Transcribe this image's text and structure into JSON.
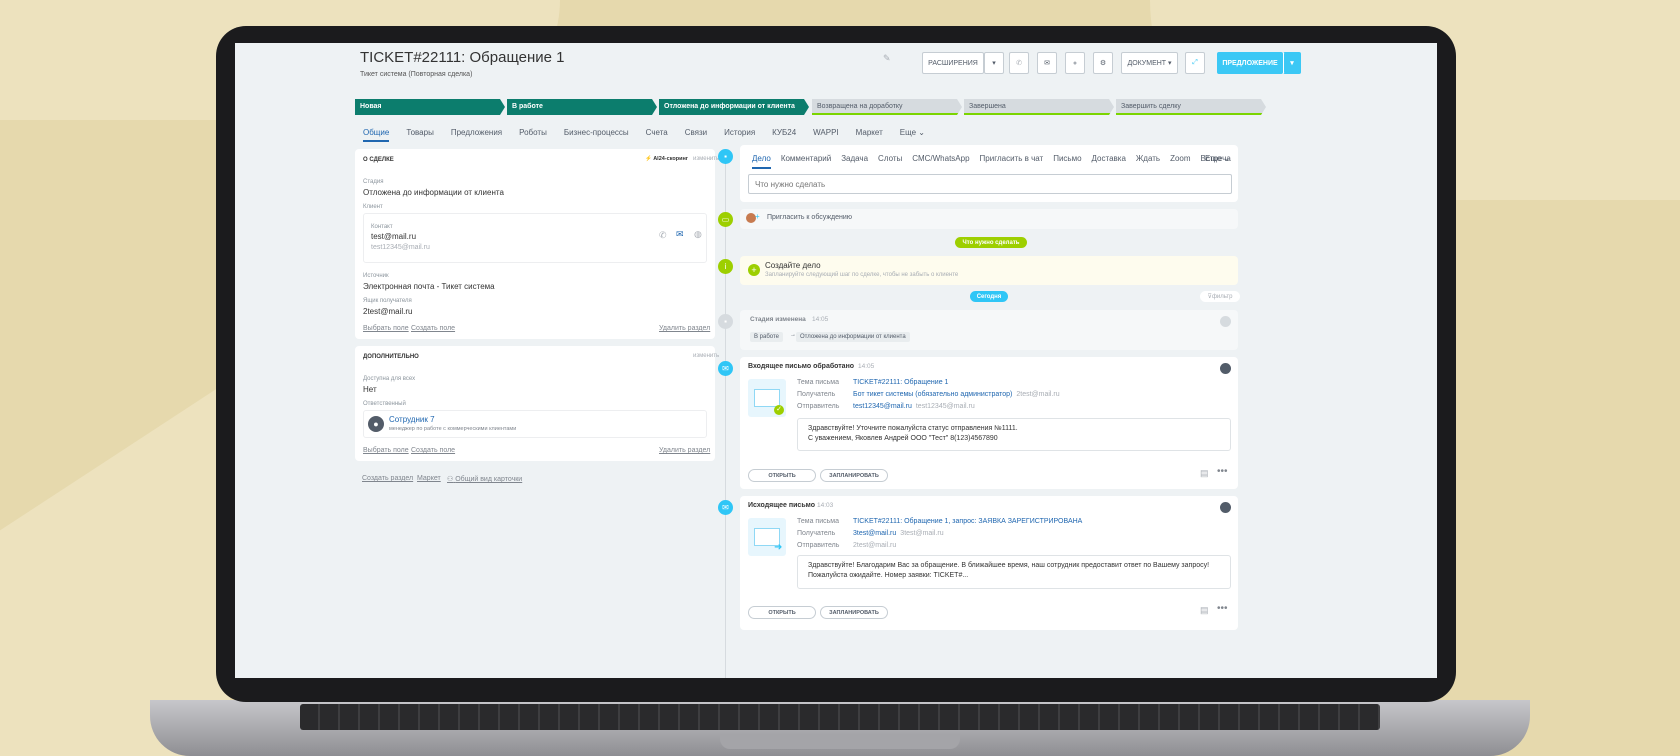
{
  "header": {
    "title": "TICKET#22111: Обращение 1",
    "subtitle": "Тикет система (Повторная сделка)",
    "btn_extensions": "РАСШИРЕНИЯ",
    "btn_document": "ДОКУМЕНТ",
    "btn_offer": "ПРЕДЛОЖЕНИЕ"
  },
  "stages": [
    "Новая",
    "В работе",
    "Отложена до информации от клиента",
    "Возвращена на доработку",
    "Завершена",
    "Завершить сделку"
  ],
  "tabs": [
    "Общие",
    "Товары",
    "Предложения",
    "Роботы",
    "Бизнес-процессы",
    "Счета",
    "Связи",
    "История",
    "КУБ24",
    "WAPPI",
    "Маркет",
    "Еще"
  ],
  "deal": {
    "section_title": "О СДЕЛКЕ",
    "ai_scoring": "AI24-скоринг",
    "change": "изменить",
    "stage_label": "Стадия",
    "stage_value": "Отложена до информации от клиента",
    "client_label": "Клиент",
    "contact_label": "Контакт",
    "contact_name": "test@mail.ru",
    "contact_email": "test12345@mail.ru",
    "source_label": "Источник",
    "source_value": "Электронная почта - Тикет система",
    "mailbox_label": "Ящик получателя",
    "mailbox_value": "2test@mail.ru",
    "select_field": "Выбрать поле",
    "create_field": "Создать поле",
    "delete_section": "Удалить раздел"
  },
  "extra": {
    "section_title": "ДОПОЛНИТЕЛЬНО",
    "change": "изменить",
    "access_label": "Доступна для всех",
    "access_value": "Нет",
    "responsible_label": "Ответственный",
    "employee_name": "Сотрудник 7",
    "employee_role": "менеджер по работе с коммерческими клиентами",
    "select_field": "Выбрать поле",
    "create_field": "Создать поле",
    "delete_section": "Удалить раздел"
  },
  "footer_links": {
    "create_section": "Создать раздел",
    "market": "Маркет",
    "card_view": "Общий вид карточки"
  },
  "activity": {
    "tabs": [
      "Дело",
      "Комментарий",
      "Задача",
      "Слоты",
      "СМС/WhatsApp",
      "Пригласить в чат",
      "Письмо",
      "Доставка",
      "Ждать",
      "Zoom",
      "Встреча",
      "Еще"
    ],
    "placeholder": "Что нужно сделать",
    "invite": "Пригласить к обсуждению",
    "todo_pill": "Что нужно сделать",
    "create_title": "Создайте дело",
    "create_hint": "Запланируйте следующий шаг по сделке, чтобы не забыть о клиенте",
    "today_pill": "Сегодня",
    "filter": "фильтр"
  },
  "stage_change": {
    "title": "Стадия изменена",
    "time": "14:05",
    "from": "В работе",
    "arrow": "→",
    "to": "Отложена до информации от клиента"
  },
  "incoming": {
    "title": "Входящее письмо обработано",
    "time": "14:05",
    "subject_label": "Тема письма",
    "subject": "TICKET#22111: Обращение 1",
    "recipient_label": "Получатель",
    "recipient": "Бот тикет системы (обязательно администратор)",
    "recipient_email": "2test@mail.ru",
    "sender_label": "Отправитель",
    "sender": "test12345@mail.ru",
    "sender_email": "test12345@mail.ru",
    "body_line1": "Здравствуйте! Уточните пожалуйста статус отправления №1111.",
    "body_line2": "С уважением, Яковлев Андрей ООО \"Тест\" 8(123)4567890",
    "open": "ОТКРЫТЬ",
    "plan": "ЗАПЛАНИРОВАТЬ"
  },
  "outgoing": {
    "title": "Исходящее письмо",
    "time": "14:03",
    "subject_label": "Тема письма",
    "subject": "TICKET#22111: Обращение 1, запрос: ЗАЯВКА ЗАРЕГИСТРИРОВАНА",
    "recipient_label": "Получатель",
    "recipient": "3test@mail.ru",
    "recipient_email": "3test@mail.ru",
    "sender_label": "Отправитель",
    "sender_email": "2test@mail.ru",
    "body_line1": "Здравствуйте! Благодарим Вас за обращение. В ближайшее время, наш сотрудник предоставит ответ по Вашему запросу!",
    "body_line2": "Пожалуйста ожидайте. Номер заявки: TICKET#...",
    "open": "ОТКРЫТЬ",
    "plan": "ЗАПЛАНИРОВАТЬ"
  },
  "icons": [
    "pencil-icon",
    "phone-icon",
    "mail-icon",
    "gear-icon",
    "chevron-down-icon",
    "plus-icon",
    "avatar-icon",
    "more-icon"
  ],
  "colors": {
    "accent": "#3bc8f5",
    "stage_done": "#0c7d6d",
    "link": "#2067b0",
    "lime": "#9dcf00"
  }
}
